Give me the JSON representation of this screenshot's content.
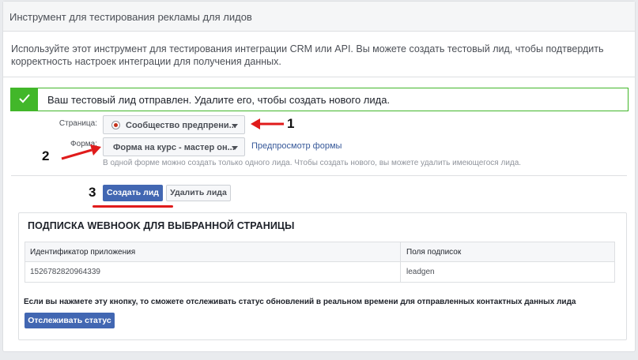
{
  "header": {
    "title": "Инструмент для тестирования рекламы для лидов"
  },
  "description": "Используйте этот инструмент для тестирования интеграции CRM или API. Вы можете создать тестовый лид, чтобы подтвердить корректность настроек интеграции для получения данных.",
  "alert": {
    "message": "Ваш тестовый лид отправлен. Удалите его, чтобы создать нового лида.",
    "icon": "check-icon",
    "color": "#42b72a"
  },
  "form": {
    "page_label": "Страница:",
    "page_value": "Сообщество предпрени...",
    "form_label": "Форма:",
    "form_value": "Форма на курс - мастер он...",
    "preview_link": "Предпросмотр формы",
    "hint": "В одной форме можно создать только одного лида. Чтобы создать нового, вы можете удалить имеющегося лида."
  },
  "actions": {
    "create_label": "Создать лид",
    "delete_label": "Удалить лида"
  },
  "annotations": {
    "n1": "1",
    "n2": "2",
    "n3": "3",
    "color": "#e01b1b"
  },
  "webhook": {
    "title": "ПОДПИСКА WEBHOOK ДЛЯ ВЫБРАННОЙ СТРАНИЦЫ",
    "columns": [
      "Идентификатор приложения",
      "Поля подписок"
    ],
    "rows": [
      [
        "1526782820964339",
        "leadgen"
      ]
    ],
    "note": "Если вы нажмете эту кнопку, то сможете отслеживать статус обновлений в реальном времени для отправленных контактных данных лида",
    "track_label": "Отслеживать статус"
  },
  "colors": {
    "primary": "#4267b2",
    "link": "#365899"
  }
}
